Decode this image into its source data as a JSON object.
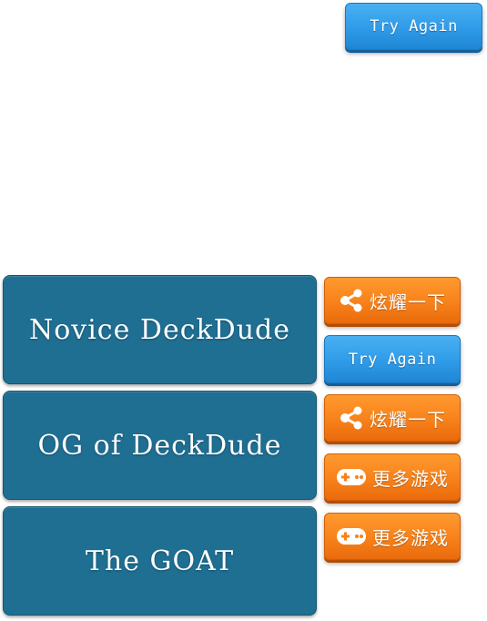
{
  "top_button": {
    "label": "Try Again"
  },
  "ranks": [
    {
      "title": "Novice DeckDude"
    },
    {
      "title": "OG of DeckDude"
    },
    {
      "title": "The GOAT"
    }
  ],
  "side_buttons": {
    "share_1": {
      "label": "炫耀一下",
      "icon": "share-icon"
    },
    "try_again": {
      "label": "Try Again"
    },
    "share_2": {
      "label": "炫耀一下",
      "icon": "share-icon"
    },
    "more_games_1": {
      "label": "更多游戏",
      "icon": "gamepad-icon"
    },
    "more_games_2": {
      "label": "更多游戏",
      "icon": "gamepad-icon"
    }
  },
  "colors": {
    "blue_button": "#2f9be8",
    "orange_button": "#f7811a",
    "card": "#1f6f93"
  }
}
